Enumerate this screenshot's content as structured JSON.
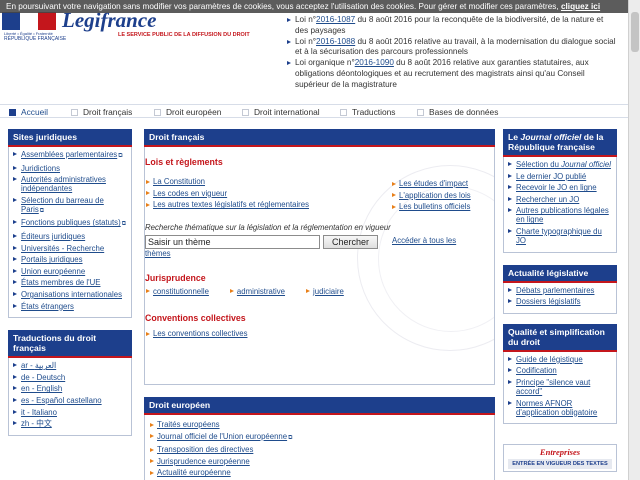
{
  "cookie": {
    "text": "En poursuivant votre navigation sans modifier vos paramètres de cookies, vous acceptez l'utilisation des cookies. Pour gérer et modifier ces paramètres,",
    "link": "cliquez ici"
  },
  "logo": {
    "brand": "Legifrance",
    "subtitle": "LE SERVICE PUBLIC DE LA DIFFUSION DU DROIT",
    "motto": "Liberté • Égalité • Fraternité",
    "republic": "RÉPUBLIQUE FRANÇAISE",
    "colors": {
      "blue": "#1d3f8c",
      "white": "#ffffff",
      "red": "#c4161c"
    }
  },
  "news": [
    {
      "prefix": "Loi n°",
      "link": "2016-1087",
      "text": " du 8 août 2016 pour la reconquête de la biodiversité, de la nature et des paysages"
    },
    {
      "prefix": "Loi n°",
      "link": "2016-1088",
      "text": " du 8 août 2016 relative au travail, à la modernisation du dialogue social et à la sécurisation des parcours professionnels"
    },
    {
      "prefix": "Loi organique n°",
      "link": "2016-1090",
      "text": " du 8 août 2016 relative aux garanties statutaires, aux obligations déontologiques et au recrutement des magistrats ainsi qu'au Conseil supérieur de la magistrature"
    }
  ],
  "nav": [
    {
      "label": "Accueil",
      "active": true
    },
    {
      "label": "Droit français",
      "active": false
    },
    {
      "label": "Droit européen",
      "active": false
    },
    {
      "label": "Droit international",
      "active": false
    },
    {
      "label": "Traductions",
      "active": false
    },
    {
      "label": "Bases de données",
      "active": false
    }
  ],
  "left": {
    "sites_title": "Sites juridiques",
    "sites": [
      "Assemblées parlementaires",
      "Juridictions",
      "Autorités administratives indépendantes",
      "Sélection du barreau de Paris",
      "Fonctions publiques (statuts)",
      "Éditeurs juridiques",
      "Universités - Recherche",
      "Portails juridiques",
      "Union européenne",
      "États membres de l'UE",
      "Organisations internationales",
      "États étrangers"
    ],
    "trad_title": "Traductions du droit français",
    "trads": [
      "ar - العربية",
      "de - Deutsch",
      "en - English",
      "es - Español castellano",
      "it - Italiano",
      "zh - 中文"
    ]
  },
  "main": {
    "title": "Droit français",
    "lois_title": "Lois et règlements",
    "lois_left": [
      "La Constitution",
      "Les codes en vigueur",
      "Les autres textes législatifs et réglementaires"
    ],
    "lois_right": [
      "Les études d'impact",
      "L'application des lois",
      "Les bulletins officiels"
    ],
    "search_caption": "Recherche thématique sur la législation et la réglementation en vigueur",
    "search_value": "Saisir un thème",
    "search_button": "Chercher",
    "all_themes_a": "Accéder à tous les",
    "all_themes_b": "thèmes",
    "juris_title": "Jurisprudence",
    "juris": [
      "constitutionnelle",
      "administrative",
      "judiciaire"
    ],
    "conv_title": "Conventions collectives",
    "conv": [
      "Les conventions collectives"
    ],
    "euro_title": "Droit européen",
    "euro": [
      "Traités européens",
      "Journal officiel de l'Union européenne",
      "Transposition des directives",
      "Jurisprudence européenne",
      "Actualité européenne"
    ]
  },
  "right": {
    "jo_title_a": "Le ",
    "jo_title_em": "Journal officiel",
    "jo_title_b": " de la République française",
    "jo_items": [
      {
        "a": "Sélection du ",
        "em": "Journal officiel",
        "b": ""
      },
      {
        "a": "Le dernier JO publié",
        "em": "",
        "b": ""
      },
      {
        "a": "Recevoir le JO en ligne",
        "em": "",
        "b": ""
      },
      {
        "a": "Rechercher un JO",
        "em": "",
        "b": ""
      },
      {
        "a": "Autres publications légales en ligne",
        "em": "",
        "b": ""
      },
      {
        "a": "Charte typographique du JO",
        "em": "",
        "b": ""
      }
    ],
    "actu_title": "Actualité législative",
    "actu": [
      "Débats parlementaires",
      "Dossiers législatifs"
    ],
    "qual_title": "Qualité et simplification du droit",
    "qual": [
      "Guide de légistique",
      "Codification",
      "Principe \"silence vaut accord\"",
      "Normes AFNOR d'application obligatoire"
    ],
    "banner_t1": "Entreprises",
    "banner_t2": "ENTRÉE EN VIGUEUR DES TEXTES"
  }
}
